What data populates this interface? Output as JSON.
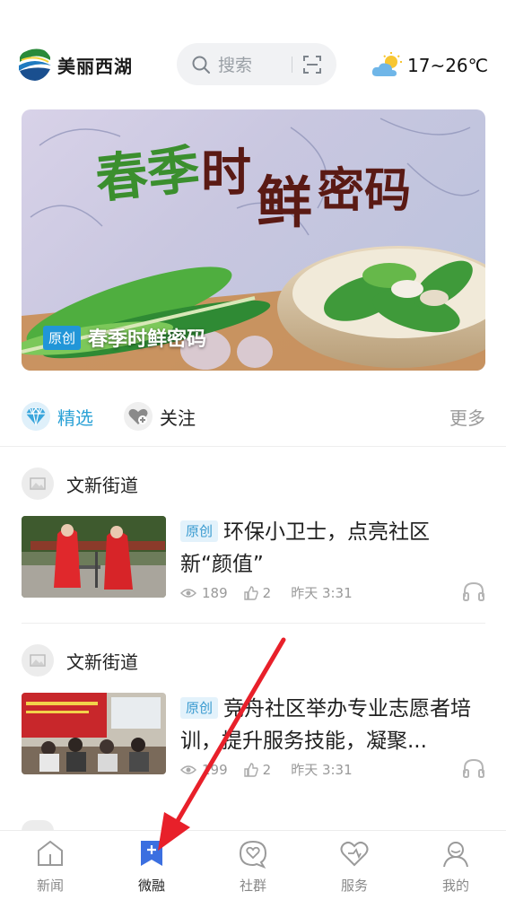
{
  "header": {
    "logo_text": "美丽西湖",
    "search_placeholder": "搜索",
    "weather": "17~26℃"
  },
  "banner": {
    "tag": "原创",
    "title": "春季时鲜密码",
    "art_title": "春季时鲜密码"
  },
  "tabs": {
    "featured": "精选",
    "follow": "关注",
    "more": "更多"
  },
  "feed": [
    {
      "source": "文新街道",
      "tag": "原创",
      "title": "环保小卫士，点亮社区新“颜值”",
      "views": "189",
      "likes": "2",
      "time": "昨天 3:31"
    },
    {
      "source": "文新街道",
      "tag": "原创",
      "title": "竞舟社区举办专业志愿者培训，提升服务技能，凝聚...",
      "views": "199",
      "likes": "2",
      "time": "昨天 3:31"
    }
  ],
  "bottom_nav": [
    {
      "label": "新闻",
      "icon": "news-icon"
    },
    {
      "label": "微融",
      "icon": "weirong-icon",
      "active": true
    },
    {
      "label": "社群",
      "icon": "community-icon"
    },
    {
      "label": "服务",
      "icon": "service-icon"
    },
    {
      "label": "我的",
      "icon": "profile-icon"
    }
  ],
  "colors": {
    "accent": "#2aa1d6",
    "tag_bg": "#2196d8",
    "annotation_arrow": "#e8202a"
  }
}
